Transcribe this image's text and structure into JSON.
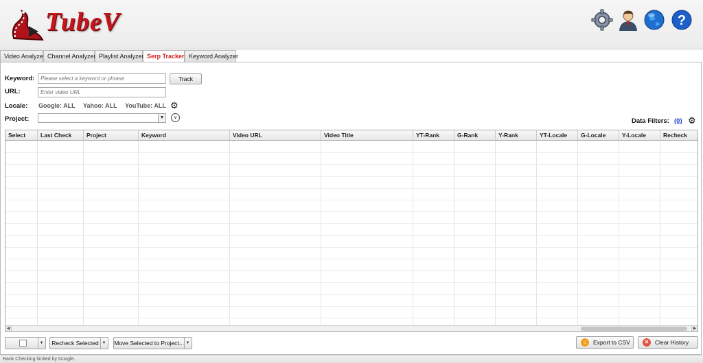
{
  "app": {
    "name": "TubeV"
  },
  "tabs": [
    {
      "label": "Video Analyzer"
    },
    {
      "label": "Channel Analyzer"
    },
    {
      "label": "Playlist Analyzer"
    },
    {
      "label": "Serp Tracker",
      "active": true
    },
    {
      "label": "Keyword Analyzer"
    }
  ],
  "header_icons": [
    "settings-gear-icon",
    "user-icon",
    "globe-icon",
    "help-icon"
  ],
  "form": {
    "keyword_label": "Keyword:",
    "keyword_placeholder": "Please select a keyword or phrase",
    "track_button": "Track",
    "url_label": "URL:",
    "url_placeholder": "Enter video URL",
    "locale_label": "Locale:",
    "locale_google": "Google: ALL",
    "locale_yahoo": "Yahoo: ALL",
    "locale_youtube": "YouTube: ALL",
    "project_label": "Project:",
    "project_value": "",
    "data_filters_label": "Data Filters:",
    "data_filters_count": "(0)"
  },
  "table": {
    "columns": [
      "Select",
      "Last Check",
      "Project",
      "Keyword",
      "Video URL",
      "Video Title",
      "YT-Rank",
      "G-Rank",
      "Y-Rank",
      "YT-Locale",
      "G-Locale",
      "Y-Locale",
      "Recheck"
    ],
    "rows": []
  },
  "footer": {
    "recheck_selected": "Recheck Selected",
    "move_selected": "Move Selected to Project...",
    "export_csv": "Export to CSV",
    "clear_history": "Clear History"
  },
  "status": {
    "text": "Rank Checking limited by Google."
  },
  "colors": {
    "accent_red": "#d21f1f",
    "logo_red": "#c4161c",
    "export_orange": "#f0a020",
    "clear_red": "#e05040"
  }
}
